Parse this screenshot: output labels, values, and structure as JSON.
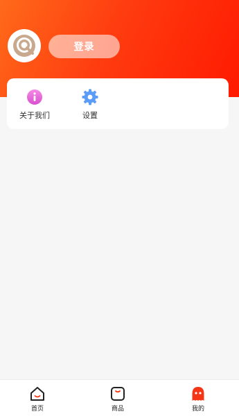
{
  "header": {
    "login_label": "登录"
  },
  "menu": {
    "items": [
      {
        "label": "关于我们",
        "icon": "info-icon"
      },
      {
        "label": "设置",
        "icon": "gear-icon"
      }
    ]
  },
  "tabbar": {
    "items": [
      {
        "label": "首页",
        "icon": "home-icon"
      },
      {
        "label": "商品",
        "icon": "goods-icon"
      },
      {
        "label": "我的",
        "icon": "profile-icon",
        "active": true
      }
    ]
  },
  "colors": {
    "header_start": "#ff6a1a",
    "header_end": "#ff1a00",
    "accent": "#f43516",
    "info": "#e76bd8",
    "settings": "#5b9cf7"
  }
}
